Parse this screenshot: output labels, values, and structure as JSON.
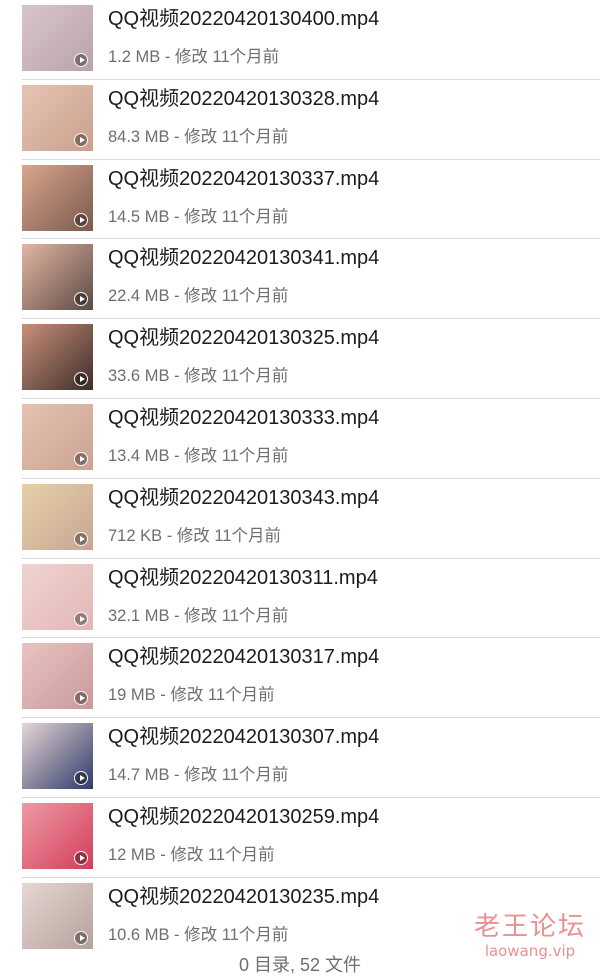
{
  "files": [
    {
      "name": "QQ视频20220420130400.mp4",
      "meta": "1.2 MB - 修改 11个月前",
      "thumb_colors": [
        "#d9c5cc",
        "#b9a3ab"
      ]
    },
    {
      "name": "QQ视频20220420130328.mp4",
      "meta": "84.3 MB - 修改 11个月前",
      "thumb_colors": [
        "#e6c4b3",
        "#c9a08d"
      ]
    },
    {
      "name": "QQ视频20220420130337.mp4",
      "meta": "14.5 MB - 修改 11个月前",
      "thumb_colors": [
        "#d9a58c",
        "#7a5a4e"
      ]
    },
    {
      "name": "QQ视频20220420130341.mp4",
      "meta": "22.4 MB - 修改 11个月前",
      "thumb_colors": [
        "#e3b6a3",
        "#5b4a44"
      ]
    },
    {
      "name": "QQ视频20220420130325.mp4",
      "meta": "33.6 MB - 修改 11个月前",
      "thumb_colors": [
        "#c9907a",
        "#3e2e2b"
      ]
    },
    {
      "name": "QQ视频20220420130333.mp4",
      "meta": "13.4 MB - 修改 11个月前",
      "thumb_colors": [
        "#e5c2b3",
        "#caa392"
      ]
    },
    {
      "name": "QQ视频20220420130343.mp4",
      "meta": "712 KB - 修改 11个月前",
      "thumb_colors": [
        "#e8cfa8",
        "#c6a693"
      ]
    },
    {
      "name": "QQ视频20220420130311.mp4",
      "meta": "32.1 MB - 修改 11个月前",
      "thumb_colors": [
        "#f0d3d1",
        "#e2b7b5"
      ]
    },
    {
      "name": "QQ视频20220420130317.mp4",
      "meta": "19 MB - 修改 11个月前",
      "thumb_colors": [
        "#e9c3c3",
        "#c9999a"
      ]
    },
    {
      "name": "QQ视频20220420130307.mp4",
      "meta": "14.7 MB - 修改 11个月前",
      "thumb_colors": [
        "#e6d6d4",
        "#2f3a6b"
      ]
    },
    {
      "name": "QQ视频20220420130259.mp4",
      "meta": "12 MB - 修改 11个月前",
      "thumb_colors": [
        "#ee9aa4",
        "#d23d5b"
      ]
    },
    {
      "name": "QQ视频20220420130235.mp4",
      "meta": "10.6 MB - 修改 11个月前",
      "thumb_colors": [
        "#e8d6d2",
        "#b4a19c"
      ]
    }
  ],
  "footer": {
    "summary": "0 目录, 52 文件"
  },
  "watermark": {
    "title": "老王论坛",
    "url": "laowang.vip"
  },
  "colors": {
    "text_primary": "#1c1c1e",
    "text_secondary": "#6e6e73",
    "divider": "#d9d9dc",
    "watermark": "#dc4646"
  },
  "icons": {
    "play": "play-circle-icon"
  }
}
